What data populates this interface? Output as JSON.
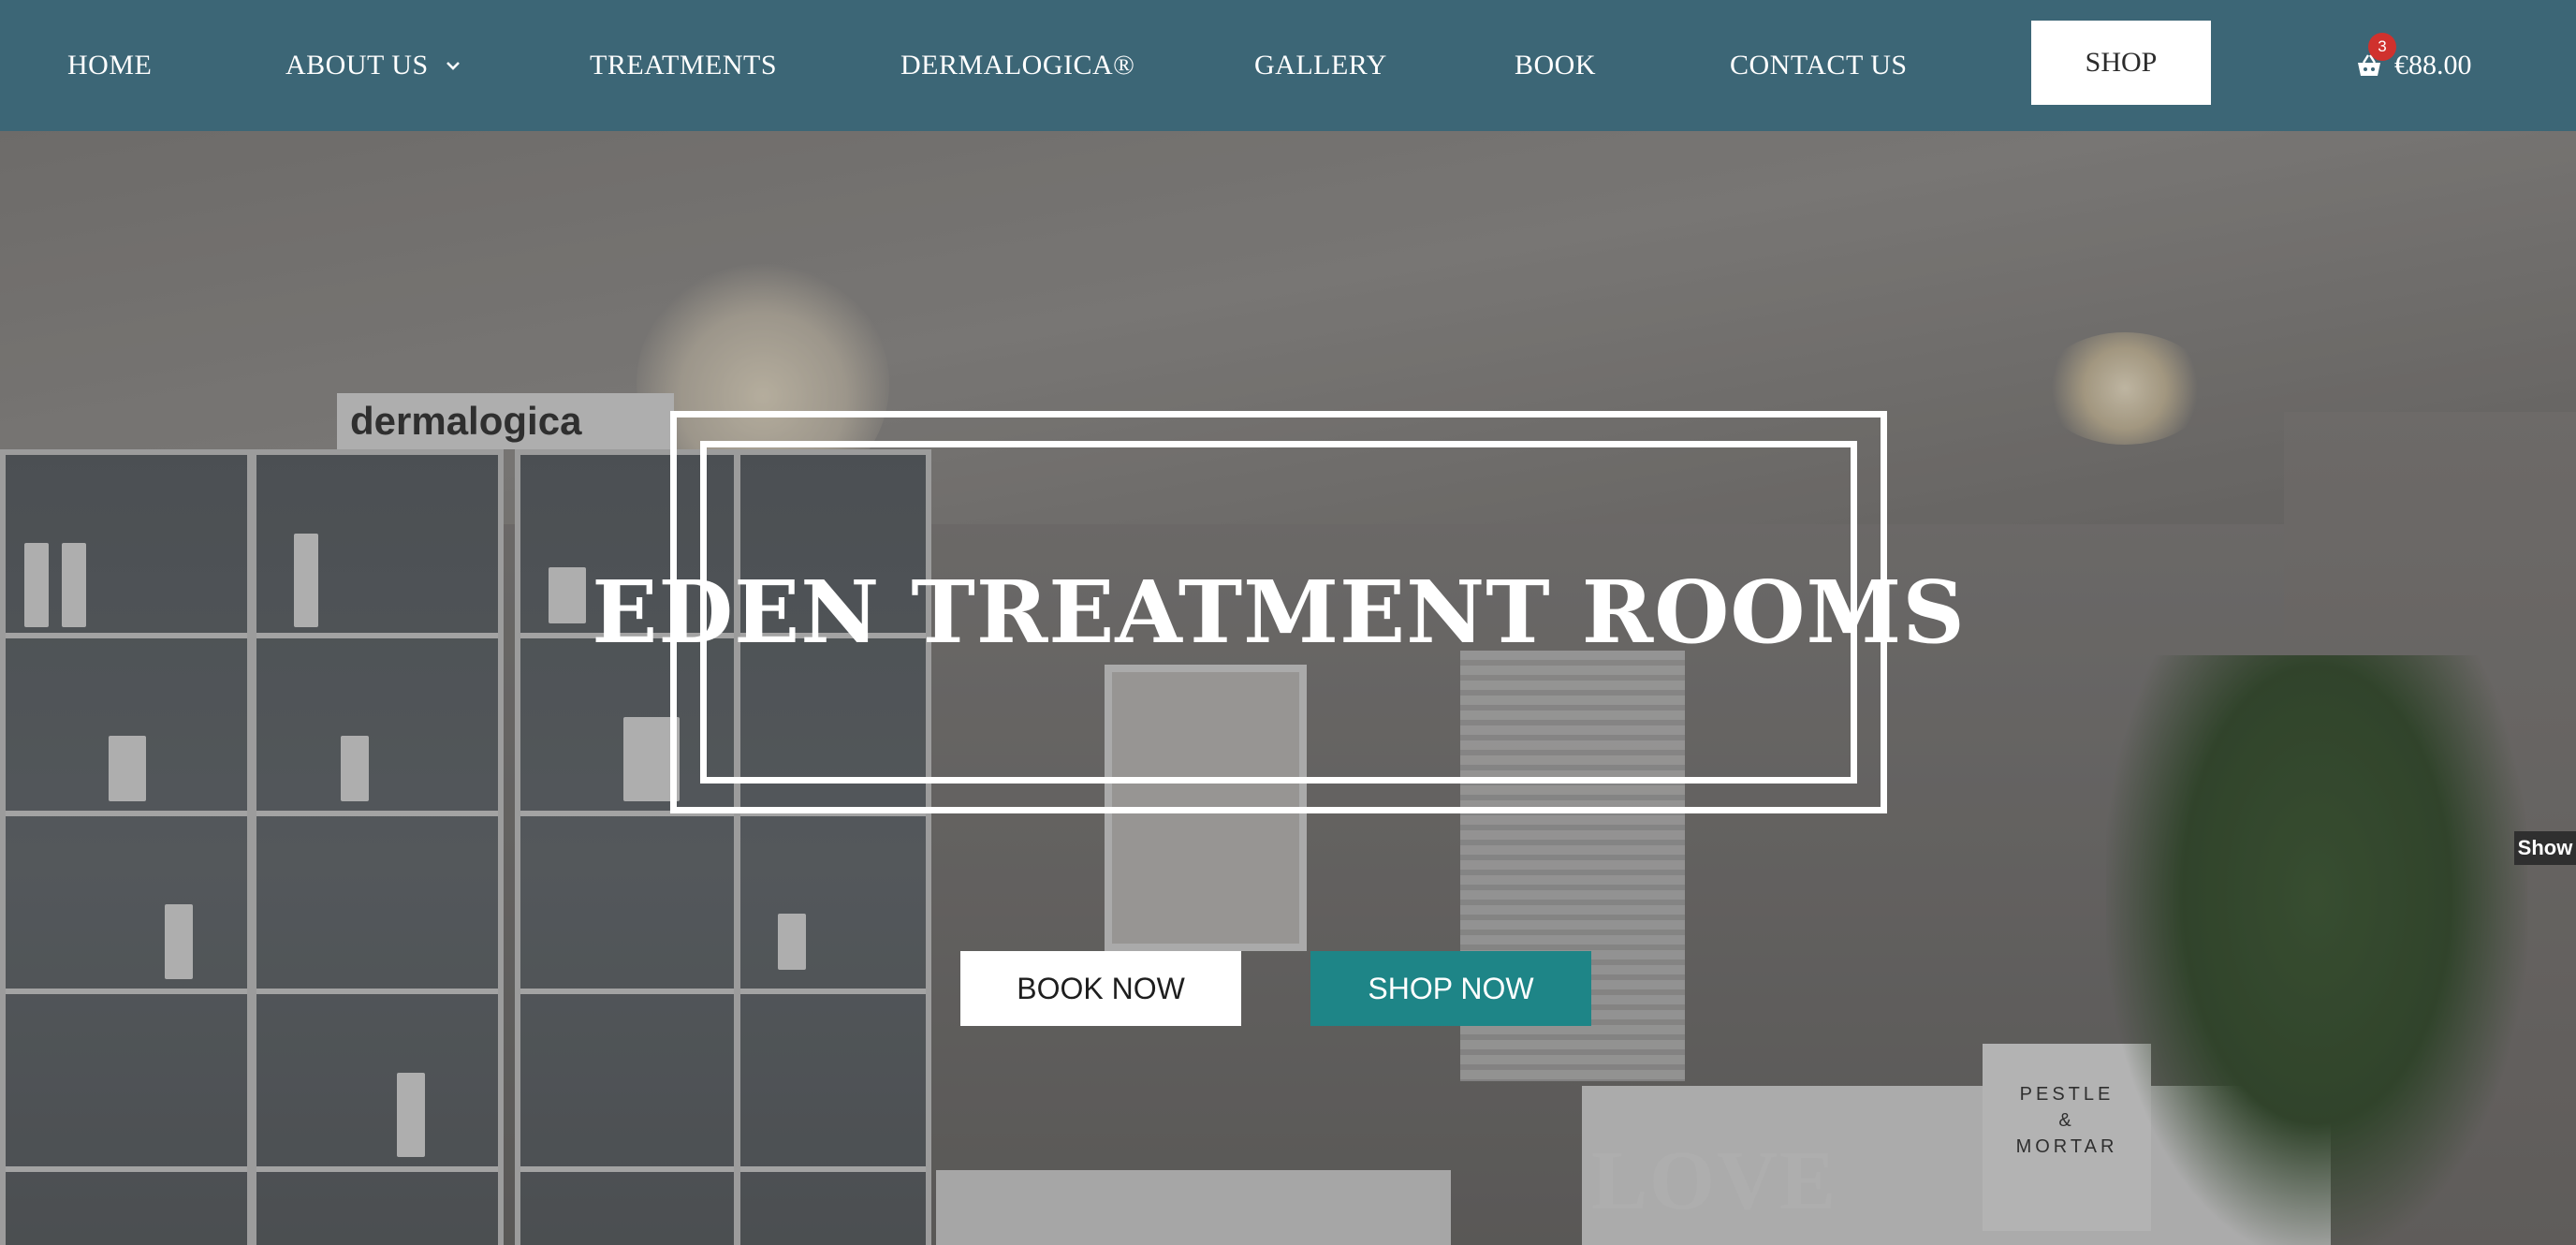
{
  "nav": {
    "items": [
      {
        "label": "HOME"
      },
      {
        "label": "ABOUT US"
      },
      {
        "label": "TREATMENTS"
      },
      {
        "label": "DERMALOGICA®"
      },
      {
        "label": "GALLERY"
      },
      {
        "label": "BOOK"
      },
      {
        "label": "CONTACT US"
      }
    ],
    "shop_label": "SHOP",
    "cart": {
      "count": "3",
      "total": "€88.00",
      "icon": "basket-icon"
    }
  },
  "hero": {
    "title": "EDEN TREATMENT ROOMS",
    "book_label": "BOOK NOW",
    "shop_label": "SHOP NOW",
    "side_tab": "Show"
  },
  "photo": {
    "brand_sign": "dermalogica",
    "pestle_lines": [
      "PESTLE",
      "&",
      "MORTAR"
    ],
    "love": "LOVE"
  },
  "colors": {
    "nav_bg": "#3c6676",
    "shop_now_bg": "#1e8587",
    "badge": "#d0312d"
  }
}
